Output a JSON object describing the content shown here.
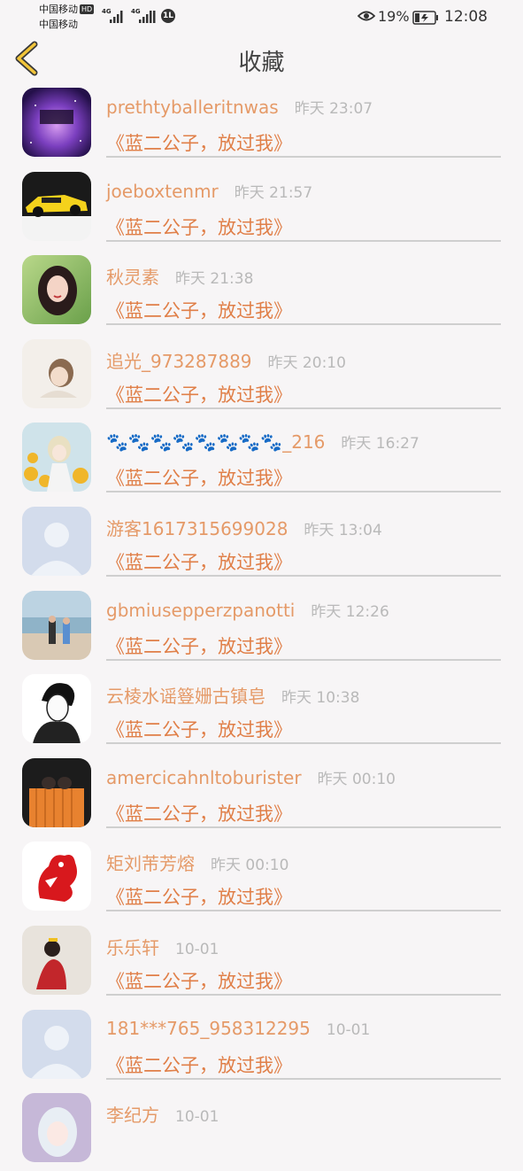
{
  "status_bar": {
    "carrier_1": "中国移动",
    "carrier_2": "中国移动",
    "hd_label": "HD",
    "network_1": "4G",
    "network_2": "4G",
    "battery_pct": "19%",
    "time": "12:08"
  },
  "header": {
    "title": "收藏"
  },
  "colors": {
    "accent": "#e59a68",
    "title_accent": "#e07f48",
    "time": "#b9b9b9",
    "background": "#f7f5f6"
  },
  "favorites": [
    {
      "user": "prethtyballeritnwas",
      "time": "昨天 23:07",
      "title": "《蓝二公子，放过我》",
      "avatar": "galaxy-avatar"
    },
    {
      "user": "joeboxtenmr",
      "time": "昨天 21:57",
      "title": "《蓝二公子，放过我》",
      "avatar": "car-avatar"
    },
    {
      "user": "秋灵素",
      "time": "昨天 21:38",
      "title": "《蓝二公子，放过我》",
      "avatar": "girl-avatar"
    },
    {
      "user": "追光_973287889",
      "time": "昨天 20:10",
      "title": "《蓝二公子，放过我》",
      "avatar": "sketch-avatar"
    },
    {
      "user": "🐾🐾🐾🐾🐾🐾🐾🐾_216",
      "time": "昨天 16:27",
      "title": "《蓝二公子，放过我》",
      "avatar": "anime-flowers-avatar"
    },
    {
      "user": "游客1617315699028",
      "time": "昨天 13:04",
      "title": "《蓝二公子，放过我》",
      "avatar": "default-avatar"
    },
    {
      "user": "gbmiusepperzpanotti",
      "time": "昨天 12:26",
      "title": "《蓝二公子，放过我》",
      "avatar": "beach-avatar"
    },
    {
      "user": "云棱水谣簦姗古镇皂",
      "time": "昨天 10:38",
      "title": "《蓝二公子，放过我》",
      "avatar": "manga-avatar"
    },
    {
      "user": "amercicahnltoburister",
      "time": "昨天 00:10",
      "title": "《蓝二公子，放过我》",
      "avatar": "couple-avatar"
    },
    {
      "user": "矩刘芾芳熔",
      "time": "昨天 00:10",
      "title": "《蓝二公子，放过我》",
      "avatar": "papercut-avatar"
    },
    {
      "user": "乐乐轩",
      "time": "10-01",
      "title": "《蓝二公子，放过我》",
      "avatar": "photo-avatar"
    },
    {
      "user": "181***765_958312295",
      "time": "10-01",
      "title": "《蓝二公子，放过我》",
      "avatar": "default-avatar"
    },
    {
      "user": "李纪方",
      "time": "10-01",
      "title": "",
      "avatar": "anime-avatar"
    }
  ]
}
